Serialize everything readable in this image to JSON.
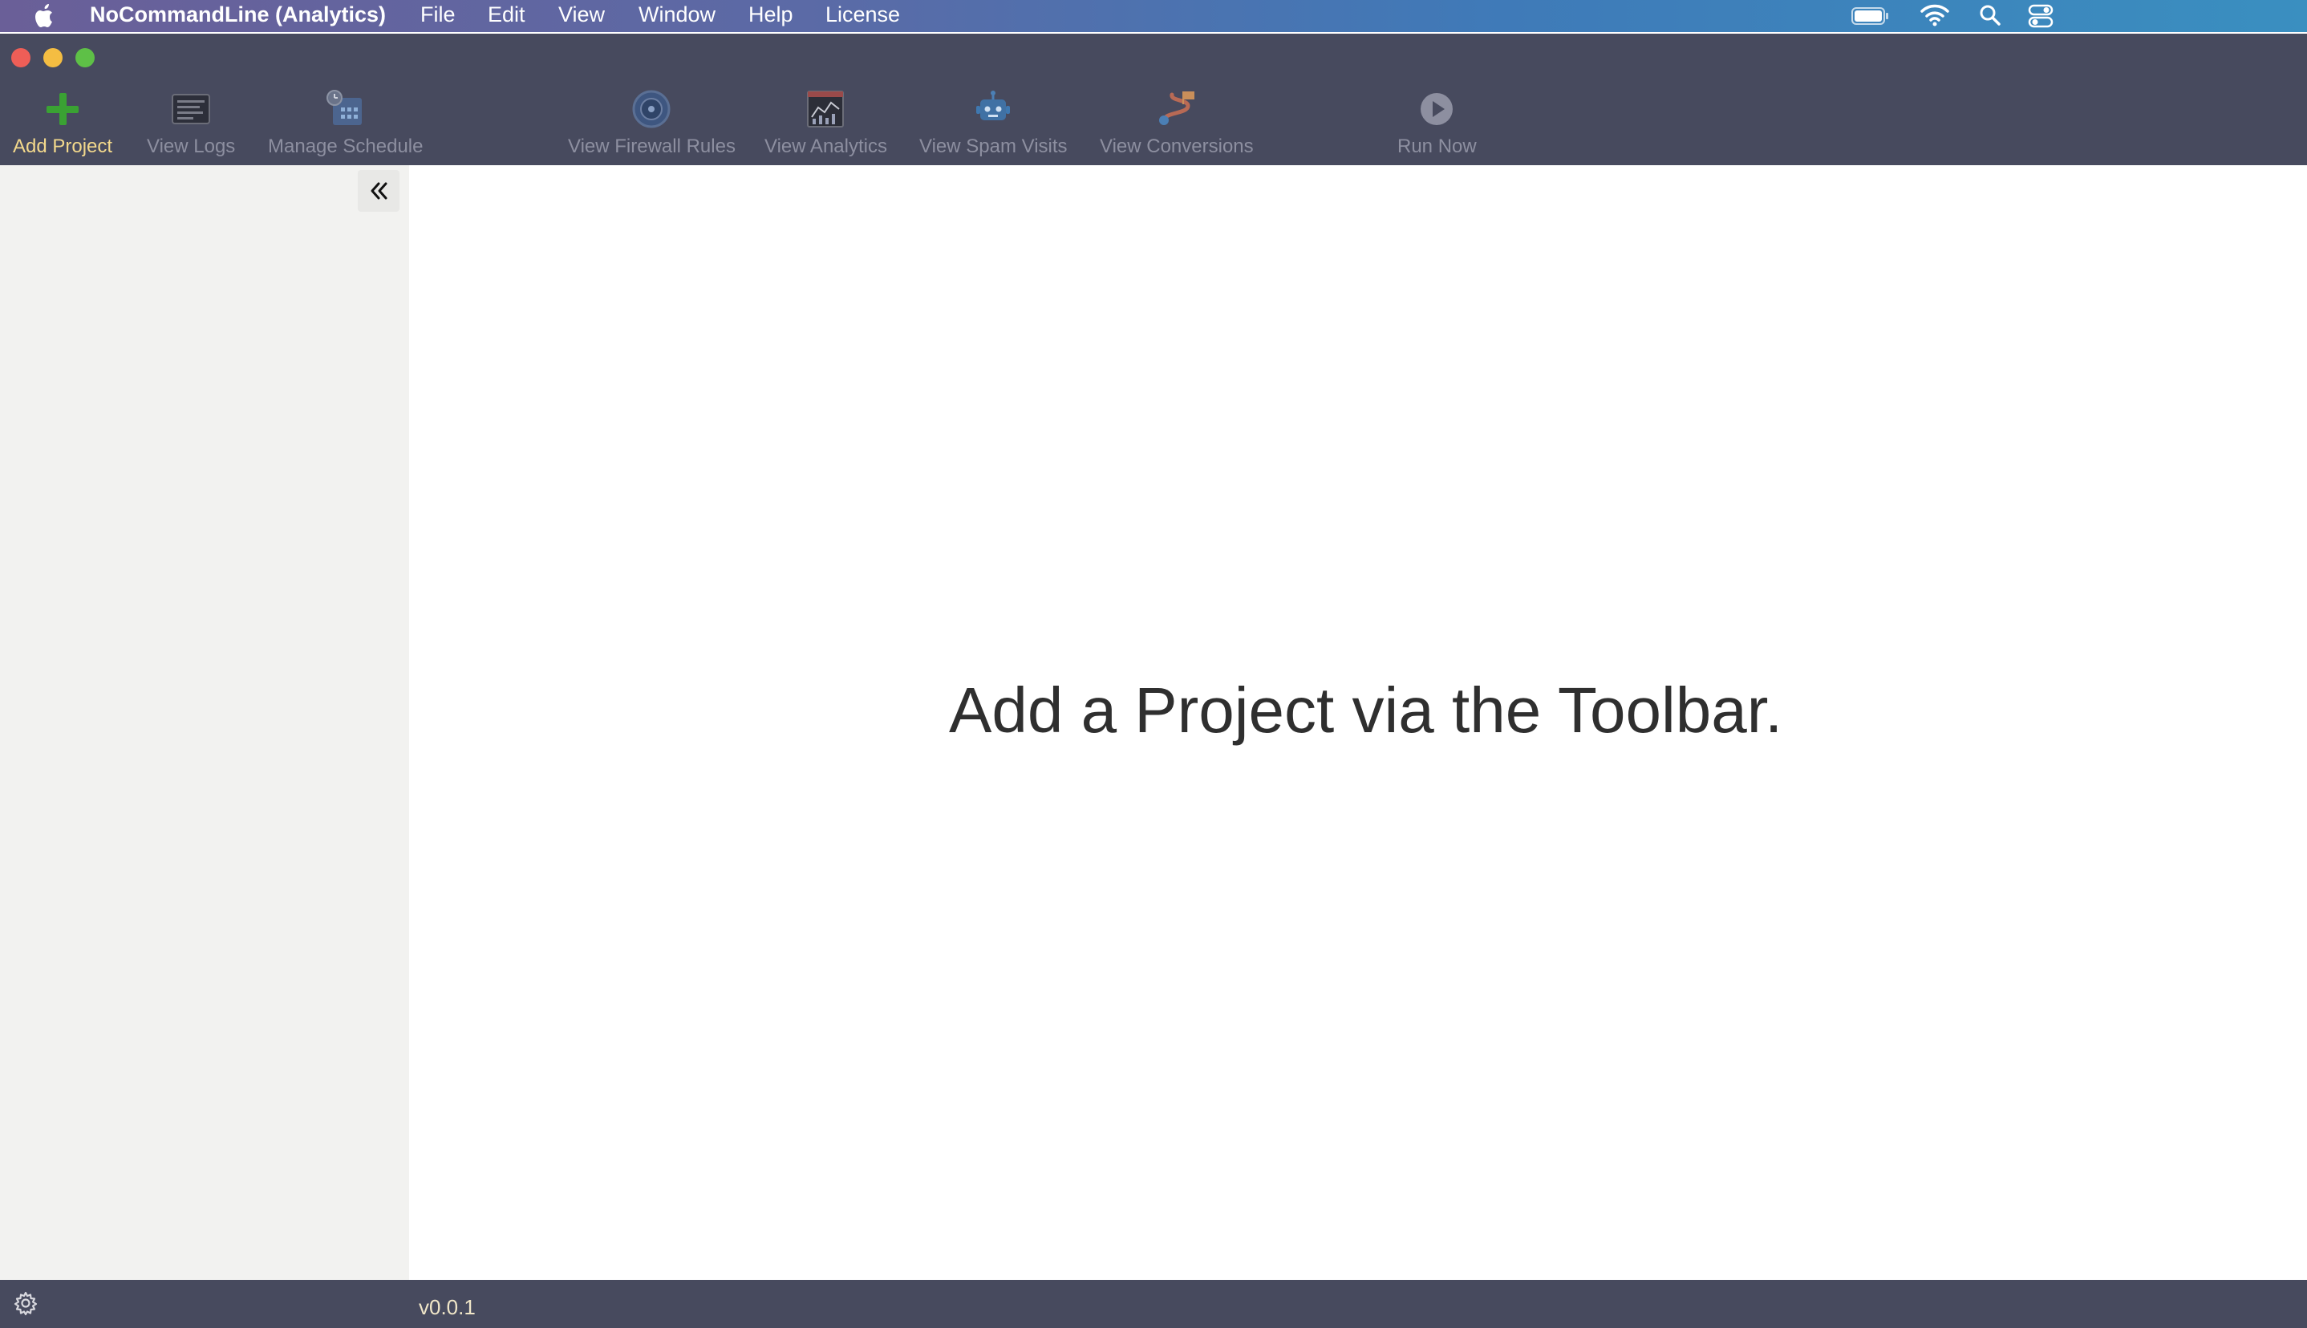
{
  "menubar": {
    "app_name": "NoCommandLine (Analytics)",
    "items": [
      "File",
      "Edit",
      "View",
      "Window",
      "Help",
      "License"
    ],
    "status_icons": [
      "battery-icon",
      "wifi-icon",
      "search-icon",
      "control-center-icon"
    ]
  },
  "window": {
    "controls": [
      "close",
      "minimize",
      "zoom"
    ]
  },
  "toolbar": {
    "add_project": "Add Project",
    "view_logs": "View Logs",
    "manage_schedule": "Manage Schedule",
    "view_firewall_rules": "View Firewall Rules",
    "view_analytics": "View Analytics",
    "view_spam_visits": "View Spam Visits",
    "view_conversions": "View Conversions",
    "run_now": "Run Now"
  },
  "main": {
    "empty_message": "Add a Project via the Toolbar."
  },
  "footer": {
    "version": "v0.0.1"
  },
  "colors": {
    "toolbar_bg": "#474a5e",
    "active_label": "#f3d98c",
    "inactive_label": "#8d8fa0",
    "sidebar_bg": "#f2f2f0"
  }
}
